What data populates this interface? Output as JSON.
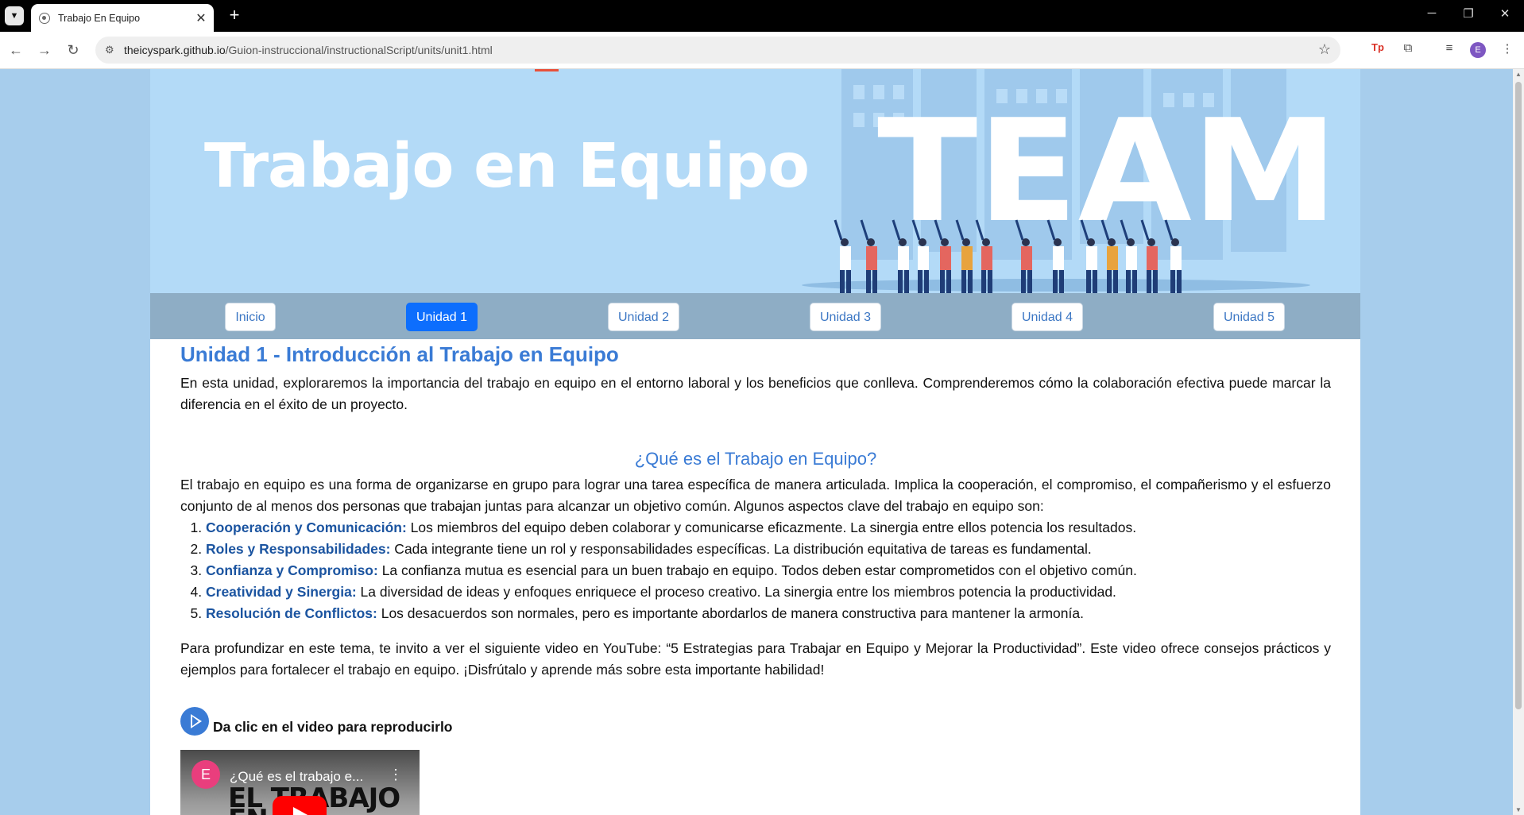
{
  "browser": {
    "tab_title": "Trabajo En Equipo",
    "url_host": "theicyspark.github.io",
    "url_path": "/Guion-instruccional/instructionalScript/units/unit1.html",
    "avatar_letter": "E"
  },
  "banner": {
    "title": "Trabajo en Equipo",
    "graphic_word": "TEAM"
  },
  "nav": {
    "items": [
      {
        "label": "Inicio",
        "active": false
      },
      {
        "label": "Unidad 1",
        "active": true
      },
      {
        "label": "Unidad 2",
        "active": false
      },
      {
        "label": "Unidad 3",
        "active": false
      },
      {
        "label": "Unidad 4",
        "active": false
      },
      {
        "label": "Unidad 5",
        "active": false
      }
    ]
  },
  "content": {
    "heading": "Unidad 1 - Introducción al Trabajo en Equipo",
    "intro": "En esta unidad, exploraremos la importancia del trabajo en equipo en el entorno laboral y los beneficios que conlleva. Comprenderemos cómo la colaboración efectiva puede marcar la diferencia en el éxito de un proyecto.",
    "subheading": "¿Qué es el Trabajo en Equipo?",
    "definition": "El trabajo en equipo es una forma de organizarse en grupo para lograr una tarea específica de manera articulada. Implica la cooperación, el compromiso, el compañerismo y el esfuerzo conjunto de al menos dos personas que trabajan juntas para alcanzar un objetivo común. Algunos aspectos clave del trabajo en equipo son:",
    "aspects": [
      {
        "term": "Cooperación y Comunicación:",
        "text": " Los miembros del equipo deben colaborar y comunicarse eficazmente. La sinergia entre ellos potencia los resultados."
      },
      {
        "term": "Roles y Responsabilidades:",
        "text": " Cada integrante tiene un rol y responsabilidades específicas. La distribución equitativa de tareas es fundamental."
      },
      {
        "term": "Confianza y Compromiso:",
        "text": " La confianza mutua es esencial para un buen trabajo en equipo. Todos deben estar comprometidos con el objetivo común."
      },
      {
        "term": "Creatividad y Sinergia:",
        "text": " La diversidad de ideas y enfoques enriquece el proceso creativo. La sinergia entre los miembros potencia la productividad."
      },
      {
        "term": "Resolución de Conflictos:",
        "text": " Los desacuerdos son normales, pero es importante abordarlos de manera constructiva para mantener la armonía."
      }
    ],
    "video_intro": "Para profundizar en este tema, te invito a ver el siguiente video en YouTube: “5 Estrategias para Trabajar en Equipo y Mejorar la Productividad”. Este video ofrece consejos prácticos y ejemplos para fortalecer el trabajo en equipo. ¡Disfrútalo y aprende más sobre esta importante habilidad!",
    "video_hint": "Da clic en el video para reproducirlo"
  },
  "video": {
    "channel_letter": "E",
    "title": "¿Qué es el trabajo e...",
    "thumbnail_text": "EL TRABAJO EN"
  },
  "colors": {
    "page_bg": "#a7cdec",
    "banner_bg": "#b3daf7",
    "nav_bg": "#8eadc5",
    "accent": "#3a7bd5",
    "active_tab": "#0d6efd",
    "keyword": "#1b54a0"
  }
}
